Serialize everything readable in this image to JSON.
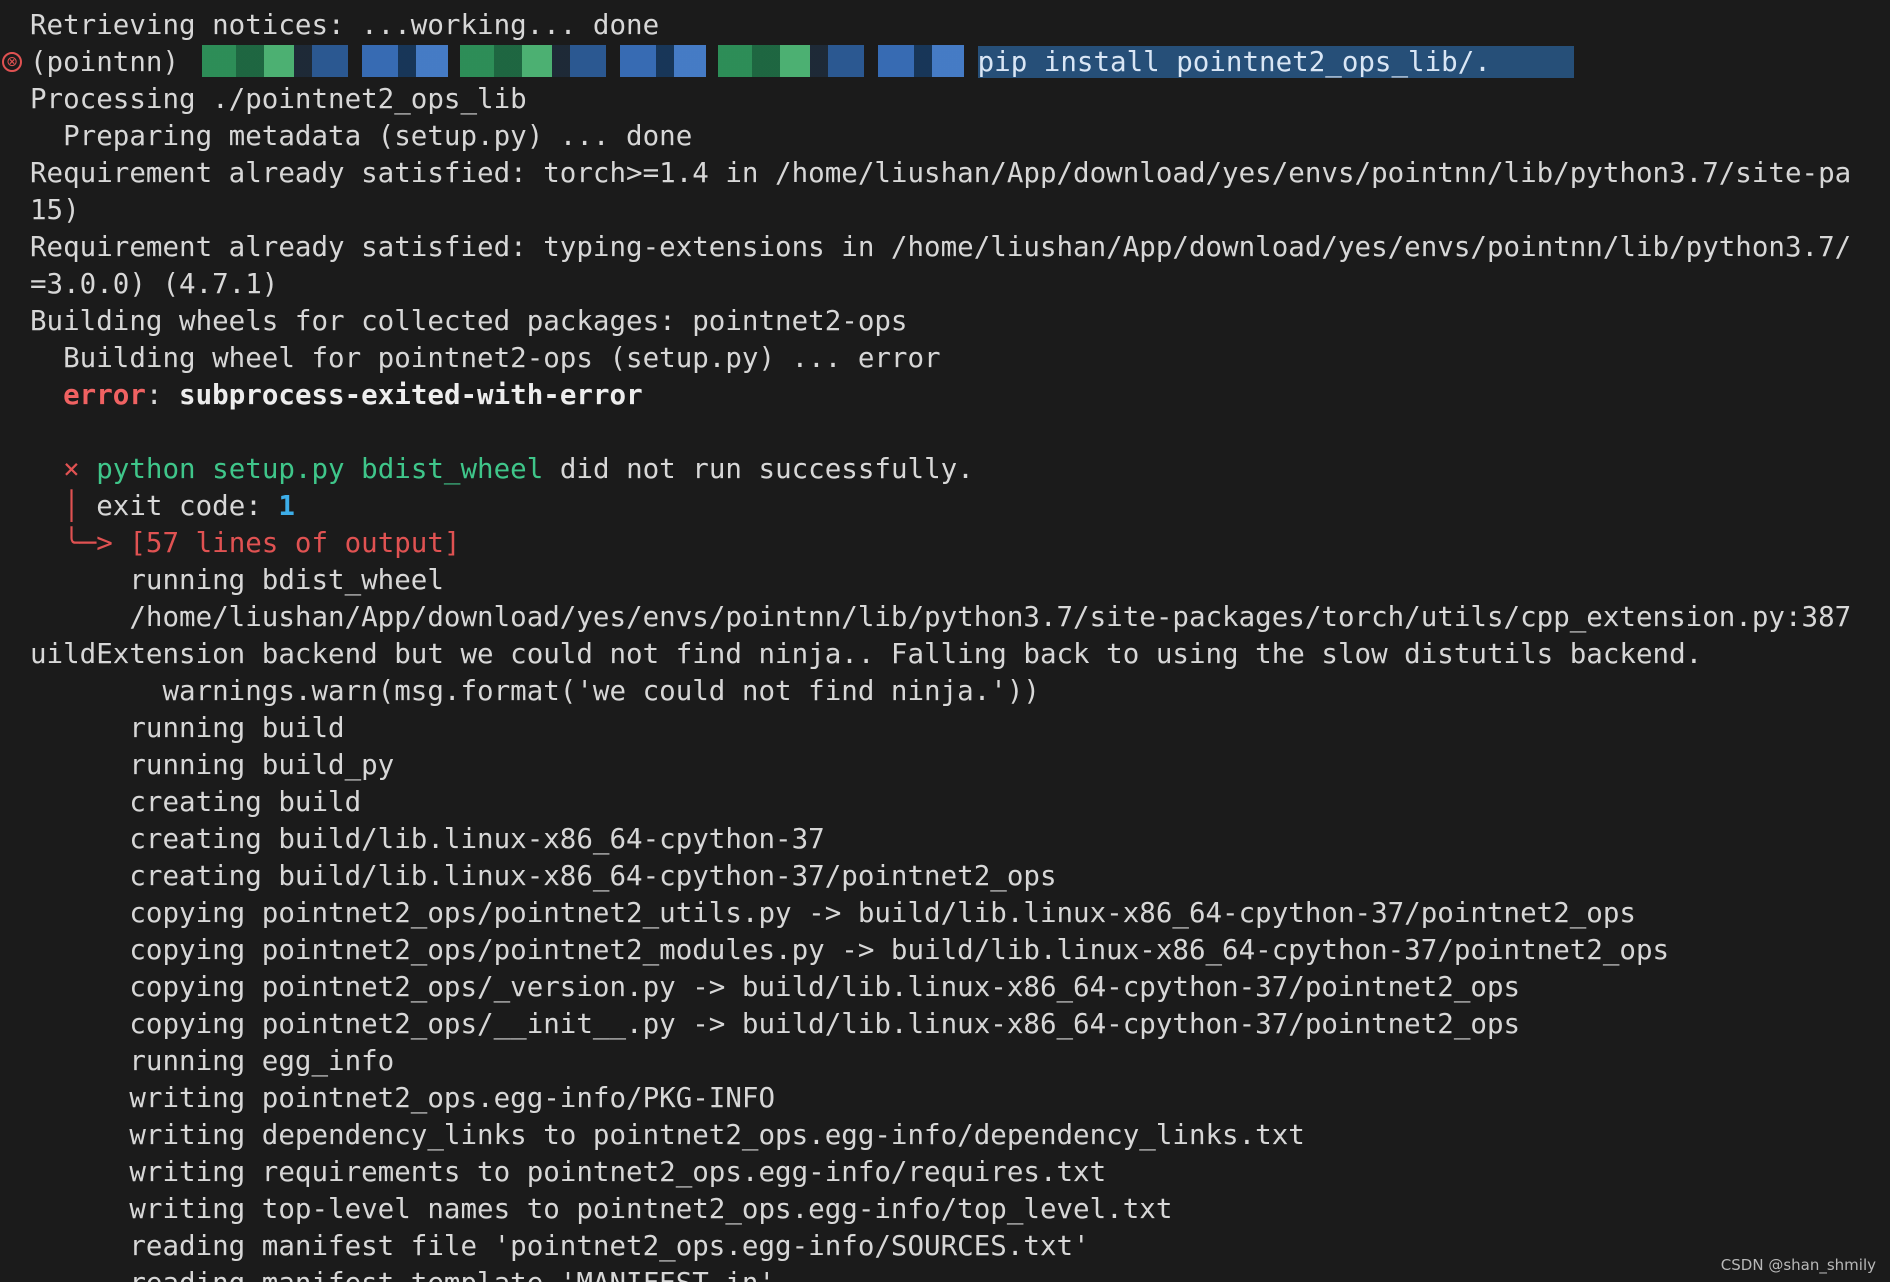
{
  "terminal": {
    "lines": {
      "l0": "Retrieving notices: ...working... done",
      "l1_prefix": "(pointnn) ",
      "l1_command": "pip install pointnet2_ops_lib/.     ",
      "l2": "Processing ./pointnet2_ops_lib",
      "l3": "  Preparing metadata (setup.py) ... done",
      "l4": "Requirement already satisfied: torch>=1.4 in /home/liushan/App/download/yes/envs/pointnn/lib/python3.7/site-pa",
      "l5": "15)",
      "l6": "Requirement already satisfied: typing-extensions in /home/liushan/App/download/yes/envs/pointnn/lib/python3.7/",
      "l7": "=3.0.0) (4.7.1)",
      "l8": "Building wheels for collected packages: pointnet2-ops",
      "l9": "  Building wheel for pointnet2-ops (setup.py) ... error",
      "l10_indent": "  ",
      "l10_error": "error",
      "l10_colon": ": ",
      "l10_msg": "subprocess-exited-with-error",
      "l11": "",
      "l12_indent": "  ",
      "l12_x": "×",
      "l12_sp": " ",
      "l12_cmd": "python setup.py bdist_wheel",
      "l12_rest": " did not run successfully.",
      "l13_indent": "  ",
      "l13_bar": "│",
      "l13_text": " exit code: ",
      "l13_code": "1",
      "l14_indent": "  ",
      "l14_arrow": "╰─>",
      "l14_text": " [57 lines of output]",
      "l15": "      running bdist_wheel",
      "l16": "      /home/liushan/App/download/yes/envs/pointnn/lib/python3.7/site-packages/torch/utils/cpp_extension.py:387",
      "l17": "uildExtension backend but we could not find ninja.. Falling back to using the slow distutils backend.",
      "l18": "        warnings.warn(msg.format('we could not find ninja.'))",
      "l19": "      running build",
      "l20": "      running build_py",
      "l21": "      creating build",
      "l22": "      creating build/lib.linux-x86_64-cpython-37",
      "l23": "      creating build/lib.linux-x86_64-cpython-37/pointnet2_ops",
      "l24": "      copying pointnet2_ops/pointnet2_utils.py -> build/lib.linux-x86_64-cpython-37/pointnet2_ops",
      "l25": "      copying pointnet2_ops/pointnet2_modules.py -> build/lib.linux-x86_64-cpython-37/pointnet2_ops",
      "l26": "      copying pointnet2_ops/_version.py -> build/lib.linux-x86_64-cpython-37/pointnet2_ops",
      "l27": "      copying pointnet2_ops/__init__.py -> build/lib.linux-x86_64-cpython-37/pointnet2_ops",
      "l28": "      running egg_info",
      "l29": "      writing pointnet2_ops.egg-info/PKG-INFO",
      "l30": "      writing dependency_links to pointnet2_ops.egg-info/dependency_links.txt",
      "l31": "      writing requirements to pointnet2_ops.egg-info/requires.txt",
      "l32": "      writing top-level names to pointnet2_ops.egg-info/top_level.txt",
      "l33": "      reading manifest file 'pointnet2_ops.egg-info/SOURCES.txt'",
      "l34": "      reading manifest template 'MANIFEST.in'"
    },
    "marker_glyph": "⊗",
    "watermark": "CSDN @shan_shmily",
    "colors": {
      "background": "#1b1b1b",
      "text": "#d7d7d7",
      "error": "#f06262",
      "command_green": "#3fc68a",
      "exit_code_blue": "#3daee9",
      "selection": "#264f78"
    }
  }
}
